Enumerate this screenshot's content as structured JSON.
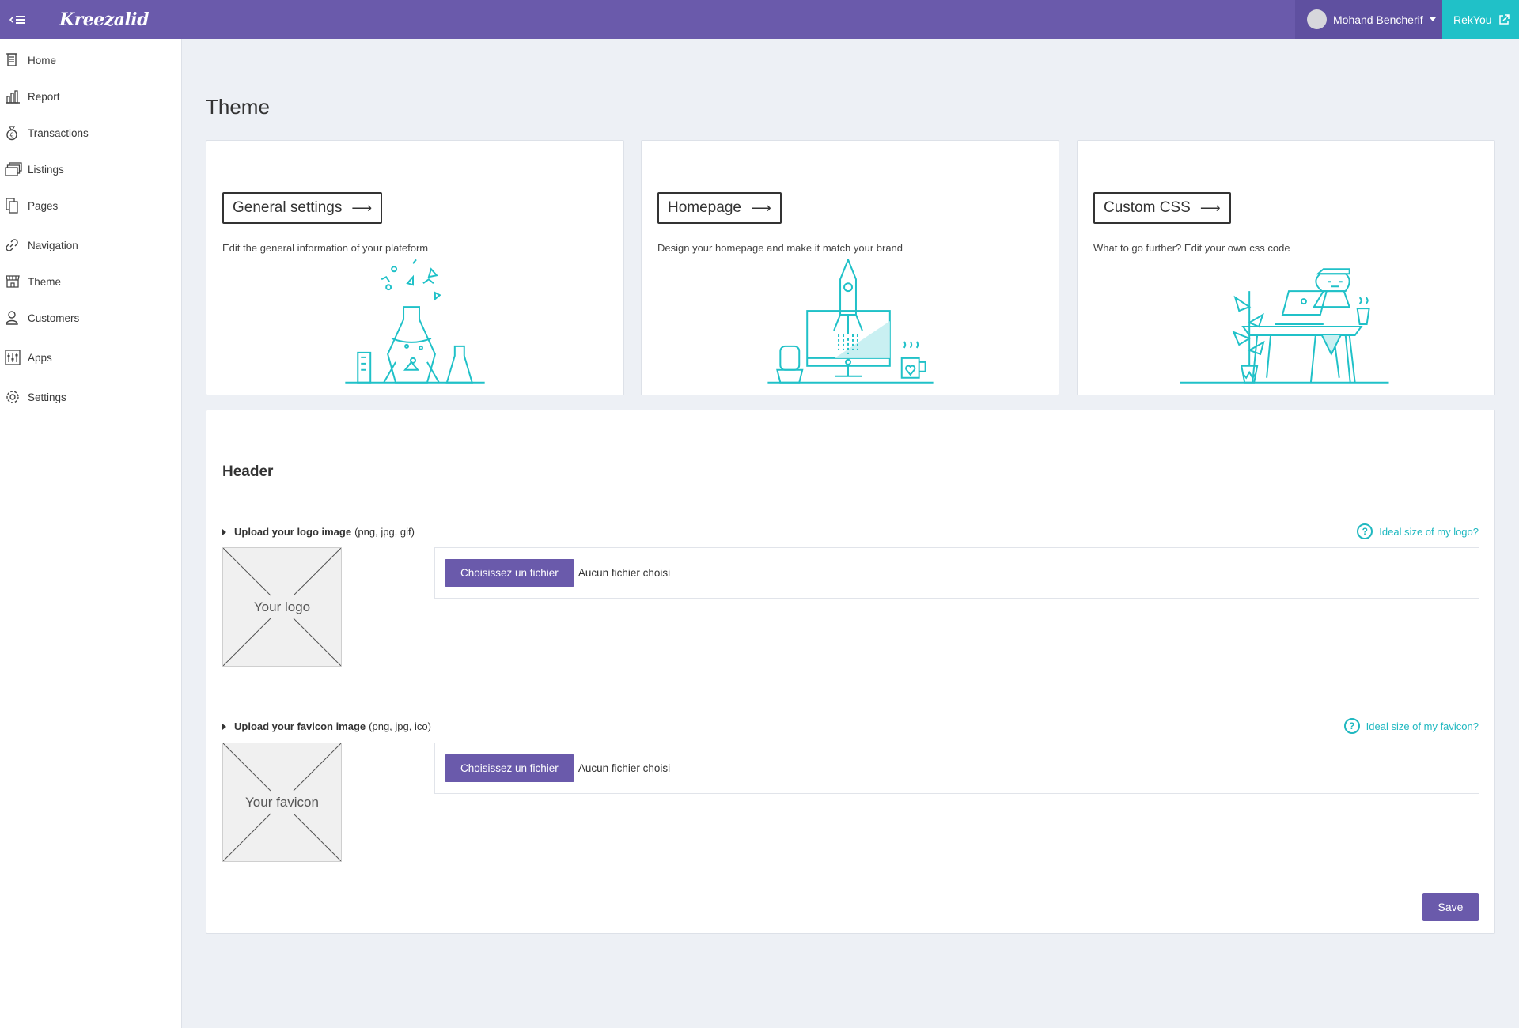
{
  "topbar": {
    "brand": "Kreezalid",
    "user_name": "Mohand Bencherif",
    "site_link": "RekYou"
  },
  "sidebar": {
    "items": [
      {
        "label": "Home",
        "icon": "home-icon"
      },
      {
        "label": "Report",
        "icon": "report-icon"
      },
      {
        "label": "Transactions",
        "icon": "money-bag-icon"
      },
      {
        "label": "Listings",
        "icon": "listings-icon"
      },
      {
        "label": "Pages",
        "icon": "pages-icon"
      },
      {
        "label": "Navigation",
        "icon": "link-icon"
      },
      {
        "label": "Theme",
        "icon": "theme-icon"
      },
      {
        "label": "Customers",
        "icon": "user-icon"
      },
      {
        "label": "Apps",
        "icon": "apps-icon"
      },
      {
        "label": "Settings",
        "icon": "gear-icon"
      }
    ]
  },
  "page": {
    "title": "Theme"
  },
  "cards": [
    {
      "button": "General settings",
      "description": "Edit the general information of your plateform",
      "illustration": "chemistry-flask-illustration"
    },
    {
      "button": "Homepage",
      "description": "Design your homepage and make it match your brand",
      "illustration": "rocket-monitor-illustration"
    },
    {
      "button": "Custom CSS",
      "description": "What to go further? Edit your own css code",
      "illustration": "developer-desk-illustration"
    }
  ],
  "header_panel": {
    "title": "Header",
    "logo": {
      "label_bold": "Upload your logo image",
      "label_formats": "(png, jpg, gif)",
      "help": "Ideal size of my logo?",
      "placeholder": "Your logo",
      "file_button": "Choisissez un fichier",
      "file_status": "Aucun fichier choisi"
    },
    "favicon": {
      "label_bold": "Upload your favicon image",
      "label_formats": "(png, jpg, ico)",
      "help": "Ideal size of my favicon?",
      "placeholder": "Your favicon",
      "file_button": "Choisissez un fichier",
      "file_status": "Aucun fichier choisi"
    },
    "save": "Save"
  },
  "colors": {
    "brand": "#6a5aab",
    "accent": "#20c1c8",
    "background": "#edf0f5"
  }
}
